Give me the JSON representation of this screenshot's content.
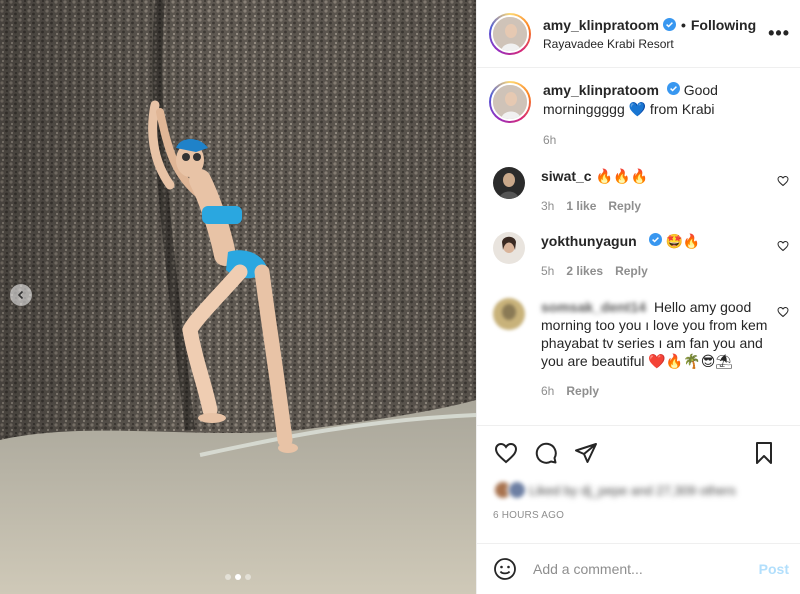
{
  "post": {
    "username": "amy_klinpratoom",
    "separator": "•",
    "follow_state": "Following",
    "location": "Rayavadee Krabi Resort",
    "more_glyph": "•••",
    "caption_text": "Good morninggggg 💙 from Krabi",
    "caption_age": "6h"
  },
  "comments": [
    {
      "username": "siwat_c",
      "text": "🔥🔥🔥",
      "age": "3h",
      "likes": "1 like",
      "reply": "Reply"
    },
    {
      "username": "yokthunyagun",
      "text": "🤩🔥",
      "age": "5h",
      "likes": "2 likes",
      "reply": "Reply"
    },
    {
      "username": "somsak_dent14",
      "text": "Hello amy good morning too you ı love you from kem phayabat tv series ı am fan you and you are beautiful ❤️🔥🌴😎⛱",
      "age": "6h",
      "reply": "Reply"
    }
  ],
  "liked_by": "Liked by dj_pepe and 27,309 others",
  "timestamp": "6 HOURS AGO",
  "add_comment": {
    "placeholder": "Add a comment...",
    "post_label": "Post"
  },
  "carousel": {
    "total": 3,
    "active": 2
  },
  "icons": {
    "verified": "verified-badge-icon",
    "like": "heart-icon",
    "comment": "comment-bubble-icon",
    "share": "paper-plane-icon",
    "save": "bookmark-icon",
    "emoji": "smiley-icon",
    "prev": "chevron-left-icon"
  },
  "colors": {
    "verified": "#3897f0",
    "post_disabled": "#b2dffc",
    "muted": "#8e8e8e",
    "swimsuit": "#2aa7e0"
  }
}
